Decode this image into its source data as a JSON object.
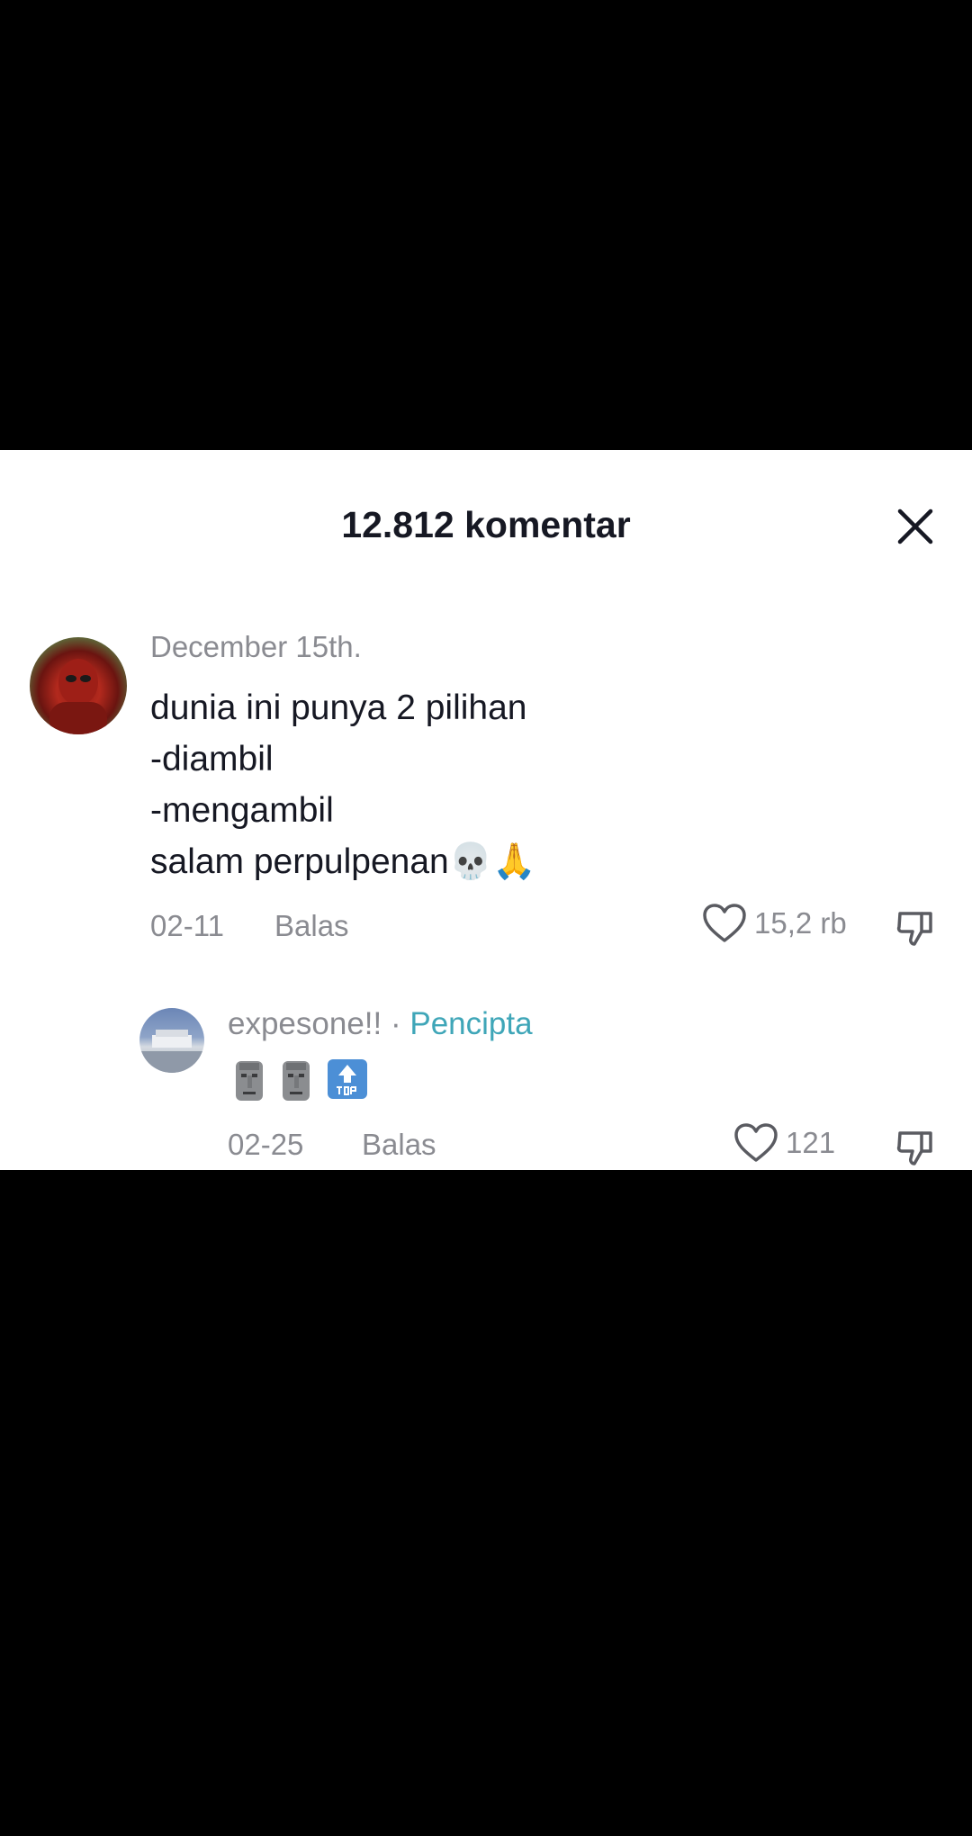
{
  "sheet": {
    "title": "12.812 komentar"
  },
  "comment": {
    "author": "December 15th.",
    "lines": [
      "dunia ini punya 2 pilihan",
      "-diambil",
      "-mengambil",
      "salam perpulpenan💀🙏"
    ],
    "date": "02-11",
    "reply_label": "Balas",
    "likes": "15,2 rb"
  },
  "reply": {
    "author": "expesone!!",
    "separator": " · ",
    "creator_label": "Pencipta",
    "emojis": [
      "moai-emoji",
      "moai-emoji",
      "top-arrow-emoji"
    ],
    "date": "02-25",
    "reply_label": "Balas",
    "likes": "121"
  },
  "colors": {
    "text_primary": "#161823",
    "text_secondary": "#8a8b91",
    "creator_accent": "#3fa6b8"
  }
}
